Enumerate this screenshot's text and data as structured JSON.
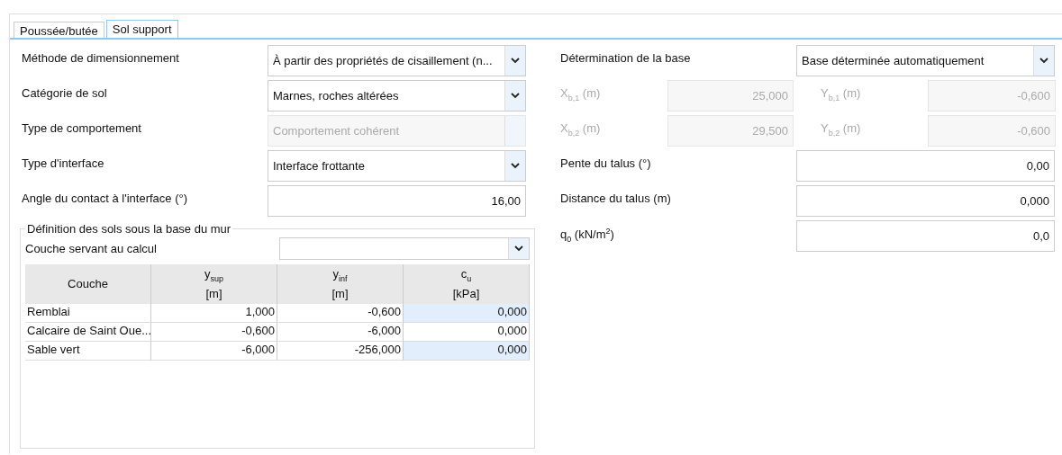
{
  "tabs": [
    {
      "label": "Poussée/butée",
      "selected": false
    },
    {
      "label": "Sol support",
      "selected": true
    }
  ],
  "left_fields": [
    {
      "kind": "select",
      "label": "Méthode de dimensionnement",
      "value": "À partir des propriétés de cisaillement (n...",
      "disabled": false
    },
    {
      "kind": "select",
      "label": "Catégorie de sol",
      "value": "Marnes, roches altérées",
      "disabled": false
    },
    {
      "kind": "select",
      "label": "Type de comportement",
      "value": "Comportement cohérent",
      "disabled": true
    },
    {
      "kind": "select",
      "label": "Type d'interface",
      "value": "Interface frottante",
      "disabled": false
    },
    {
      "kind": "input",
      "label": "Angle du contact à l'interface (°)",
      "value": "16,00",
      "disabled": false
    }
  ],
  "soil_group": {
    "title": "Définition des sols sous la base du mur",
    "layer_select": {
      "label": "Couche servant au calcul"
    },
    "columns": [
      {
        "label": "Couche"
      },
      {
        "label": "y$_{sup}$",
        "unit": "[m]"
      },
      {
        "label": "y$_{inf}$",
        "unit": "[m]"
      },
      {
        "label": "c$_{u}$",
        "unit": "[kPa]"
      }
    ],
    "rows": [
      {
        "couche": "Remblai",
        "y_sup": "1,000",
        "y_inf": "-0,600",
        "c_u": "0,000",
        "highlighted": true
      },
      {
        "couche": "Calcaire de Saint Oue...",
        "y_sup": "-0,600",
        "y_inf": "-6,000",
        "c_u": "0,000",
        "highlighted": false
      },
      {
        "couche": "Sable vert",
        "y_sup": "-6,000",
        "y_inf": "-256,000",
        "c_u": "0,000",
        "highlighted": true
      }
    ]
  },
  "base": {
    "label": "Détermination de la base",
    "value": "Base déterminée automatiquement",
    "points": [
      {
        "x_label": "X$_{b,1}$ (m)",
        "x_value": "25,000",
        "y_label": "Y$_{b,1}$ (m)",
        "y_value": "-0,600",
        "disabled": true
      },
      {
        "x_label": "X$_{b,2}$ (m)",
        "x_value": "29,500",
        "y_label": "Y$_{b,2}$ (m)",
        "y_value": "-0,600",
        "disabled": true
      }
    ]
  },
  "right_fields": [
    {
      "label": "Pente du talus (°)",
      "value": "0,00"
    },
    {
      "label": "Distance du talus (m)",
      "value": "0,000"
    },
    {
      "label": "q$_{0}$ (kN/m$^{2}$)",
      "value": "0,0"
    }
  ]
}
